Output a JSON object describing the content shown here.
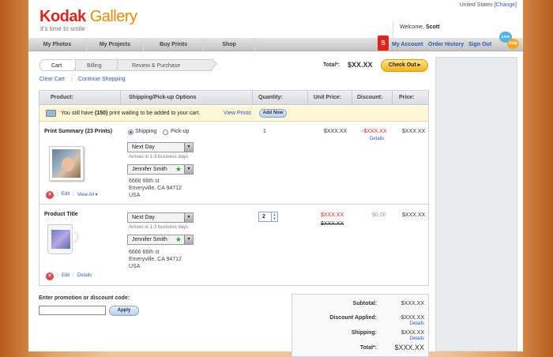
{
  "header": {
    "logo_brand": "Kodak",
    "logo_product": "Gallery",
    "tagline": "it's time to smile",
    "country": "United States",
    "country_change": "[Change]",
    "welcome_prefix": "Welcome, ",
    "welcome_name": "Scott",
    "badge": "S",
    "live_line1": "Live",
    "live_line2": "Help"
  },
  "nav": {
    "tabs": [
      "My Photos",
      "My Projects",
      "Buy Prints",
      "Shop"
    ],
    "account": [
      "My Account",
      "Order History",
      "Sign Out"
    ]
  },
  "steps": [
    "Cart",
    "Billing",
    "Review & Purchase"
  ],
  "cart_links": [
    "Clear Cart",
    "Continue Shopping"
  ],
  "total": {
    "label": "Total*:",
    "value": "$XX.XX",
    "checkout": "Check Out ▸"
  },
  "table": {
    "headers": [
      "Product:",
      "Shipping/Pick-up Options",
      "Quantity:",
      "Unit Price:",
      "Discount:",
      "Price:"
    ],
    "notice": {
      "pre": "You still have ",
      "count": "(150)",
      "post": " print waiting to be added to your cart.",
      "view": "View Prints",
      "add": "Add Now"
    },
    "rows": [
      {
        "title": "Print Summary (23 Prints)",
        "shipping_option": "Shipping",
        "pickup_option": "Pick-up",
        "speed": "Next Day",
        "arrives": "Arrives in 1-3 business days",
        "recipient": "Jennifer Smith",
        "address": [
          "6666 66th st",
          "Emeryville, CA 94712",
          "USA"
        ],
        "quantity": "1",
        "unit_price": "$XXX.XX",
        "discount": "-$XXX.XX",
        "discount_details": "Details",
        "price": "$XXX.XX",
        "actions": [
          "Edit",
          "View All ▾"
        ]
      },
      {
        "title": "Product Title",
        "speed": "Next Day",
        "arrives": "Arrives in 1-3 business days",
        "recipient": "Jennifer Smith",
        "address": [
          "6666 66th st",
          "Emeryville, CA 94712",
          "USA"
        ],
        "quantity": "2",
        "unit_price": "$XXX.XX",
        "unit_price_old": "$XXX.XX",
        "discount": "$0.00",
        "price": "$XXX.XX",
        "actions": [
          "Edit",
          "Details"
        ]
      }
    ]
  },
  "promo": {
    "label": "Enter promotion or discount code:",
    "value": "",
    "apply": "Apply"
  },
  "summary": {
    "subtotal_label": "Subtotal:",
    "subtotal": "$XXX.XX",
    "discount_label": "Discount Applied:",
    "discount": "-$XXX.XX",
    "discount_details": "Details",
    "shipping_label": "Shipping:",
    "shipping": "$XXX.XX",
    "shipping_details": "Details",
    "total_label": "Total*:",
    "total": "$XXX.XX"
  },
  "colors": {
    "brand_red": "#e2231a",
    "brand_orange": "#e98a00",
    "link_blue": "#2a59b7",
    "checkout_yellow": "#f7b318"
  }
}
